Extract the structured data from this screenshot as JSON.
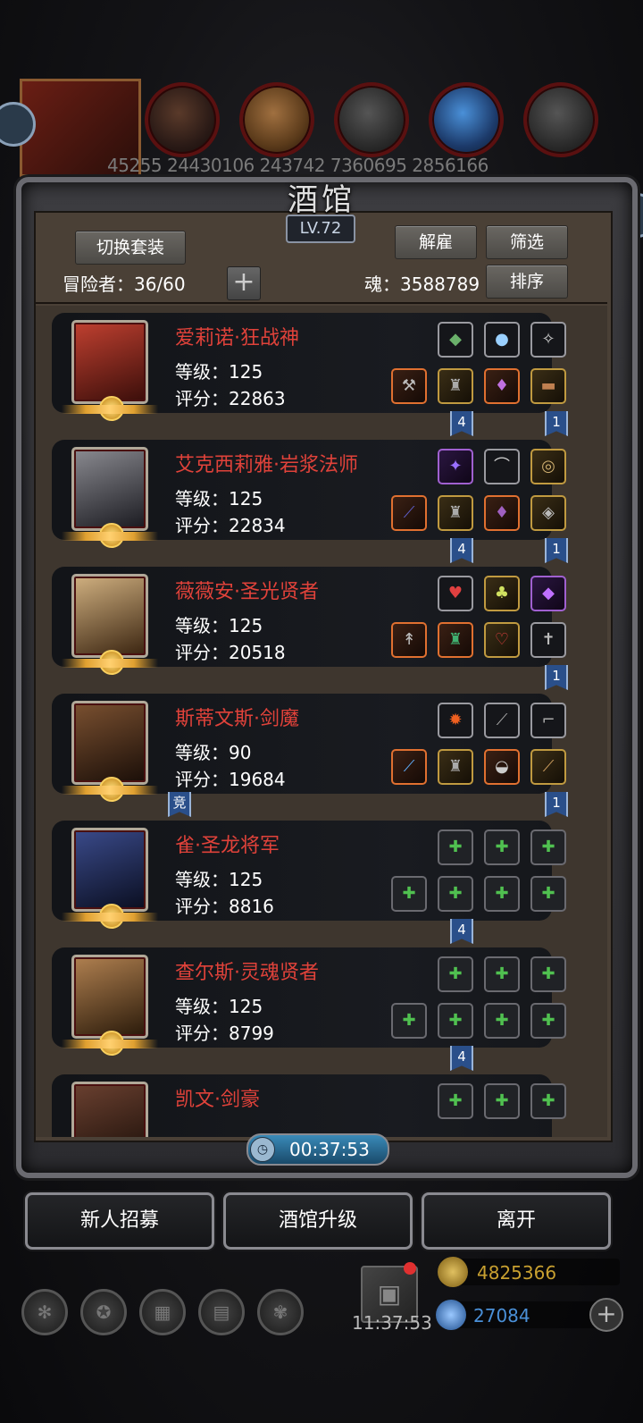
{
  "top_resources": {
    "values_text": "45255 24430106 243742 7360695 2856166"
  },
  "panel": {
    "title": "酒馆",
    "level": "LV.72",
    "switch_outfit_label": "切换套装",
    "dismiss_label": "解雇",
    "filter_label": "筛选",
    "sort_label": "排序",
    "adventurers_label": "冒险者：36/60",
    "add_label": "+",
    "soul_label": "魂：3588789"
  },
  "heroes": [
    {
      "name": "爱莉诺·狂战神",
      "level": "等级：125",
      "score": "评分：22863",
      "flags": [
        "4",
        "1"
      ]
    },
    {
      "name": "艾克西莉雅·岩浆法师",
      "level": "等级：125",
      "score": "评分：22834",
      "flags": [
        "4",
        "1"
      ]
    },
    {
      "name": "薇薇安·圣光贤者",
      "level": "等级：125",
      "score": "评分：20518",
      "flags": [
        "1"
      ]
    },
    {
      "name": "斯蒂文斯·剑魔",
      "level": "等级：90",
      "score": "评分：19684",
      "flags": [
        "竞",
        "1"
      ]
    },
    {
      "name": "雀·圣龙将军",
      "level": "等级：125",
      "score": "评分：8816",
      "flags": [
        "4"
      ]
    },
    {
      "name": "查尔斯·灵魂贤者",
      "level": "等级：125",
      "score": "评分：8799",
      "flags": [
        "4"
      ]
    },
    {
      "name": "凯文·剑豪",
      "level": "",
      "score": "",
      "flags": []
    }
  ],
  "timer": "00:37:53",
  "bottom_buttons": {
    "recruit": "新人招募",
    "upgrade": "酒馆升级",
    "leave": "离开"
  },
  "gift_time": "11:37:53",
  "currency": {
    "gold": "4825366",
    "gem": "27084"
  },
  "colors": {
    "hero_name": "#e0423a",
    "flag_blue": "#2a4f8a",
    "gold_text": "#c8a030",
    "gem_text": "#4a90d8"
  }
}
